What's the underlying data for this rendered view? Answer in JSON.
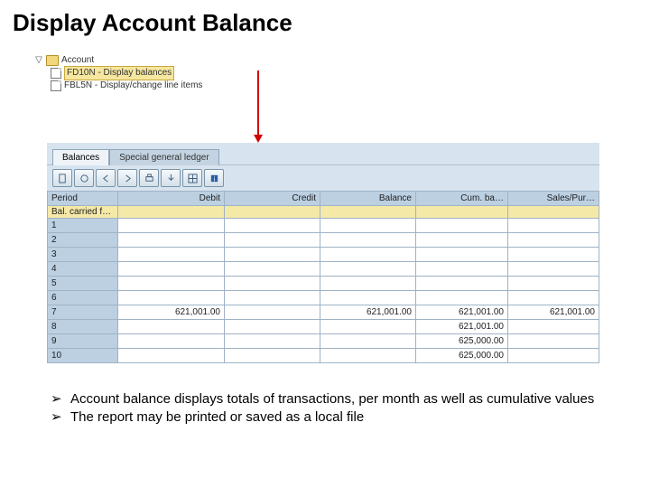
{
  "slide": {
    "title": "Display Account Balance"
  },
  "tree": {
    "root_toggle": "▽",
    "root_label": "Account",
    "items": [
      {
        "label": "FD10N - Display balances",
        "highlighted": true
      },
      {
        "label": "FBL5N - Display/change line items",
        "highlighted": false
      }
    ]
  },
  "panel": {
    "tabs": [
      {
        "label": "Balances",
        "active": true
      },
      {
        "label": "Special general ledger",
        "active": false
      }
    ],
    "columns": [
      "Period",
      "Debit",
      "Credit",
      "Balance",
      "Cum. ba…",
      "Sales/Pur…"
    ],
    "carry_row_label": "Bal. carried f…",
    "rows": [
      {
        "period": "1",
        "debit": "",
        "credit": "",
        "balance": "",
        "cum": "",
        "sales": ""
      },
      {
        "period": "2",
        "debit": "",
        "credit": "",
        "balance": "",
        "cum": "",
        "sales": ""
      },
      {
        "period": "3",
        "debit": "",
        "credit": "",
        "balance": "",
        "cum": "",
        "sales": ""
      },
      {
        "period": "4",
        "debit": "",
        "credit": "",
        "balance": "",
        "cum": "",
        "sales": ""
      },
      {
        "period": "5",
        "debit": "",
        "credit": "",
        "balance": "",
        "cum": "",
        "sales": ""
      },
      {
        "period": "6",
        "debit": "",
        "credit": "",
        "balance": "",
        "cum": "",
        "sales": ""
      },
      {
        "period": "7",
        "debit": "621,001.00",
        "credit": "",
        "balance": "621,001.00",
        "cum": "621,001.00",
        "sales": "621,001.00"
      },
      {
        "period": "8",
        "debit": "",
        "credit": "",
        "balance": "",
        "cum": "621,001.00",
        "sales": ""
      },
      {
        "period": "9",
        "debit": "",
        "credit": "",
        "balance": "",
        "cum": "625,000.00",
        "sales": ""
      },
      {
        "period": "10",
        "debit": "",
        "credit": "",
        "balance": "",
        "cum": "625,000.00",
        "sales": ""
      }
    ]
  },
  "bullets": {
    "marker": "➢",
    "items": [
      "Account balance displays totals of transactions, per month as well as cumulative values",
      "The report may be printed or saved as a local file"
    ]
  }
}
